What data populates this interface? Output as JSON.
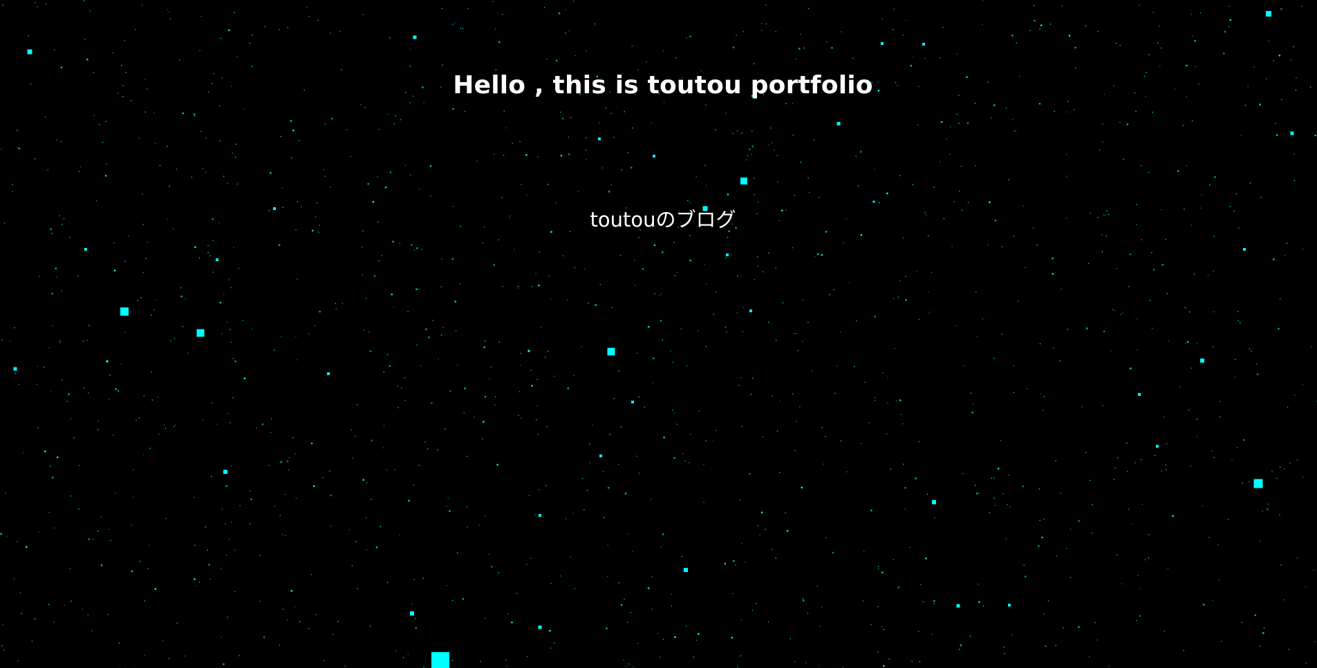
{
  "page": {
    "title": "Hello , this is toutou portfolio",
    "blog_link_label": "toutouのブログ"
  },
  "theme": {
    "background": "#000000",
    "text_color": "#ffffff",
    "star_color": "#00ffff"
  },
  "background_effect": {
    "kind": "starfield",
    "star_shape": "square"
  }
}
